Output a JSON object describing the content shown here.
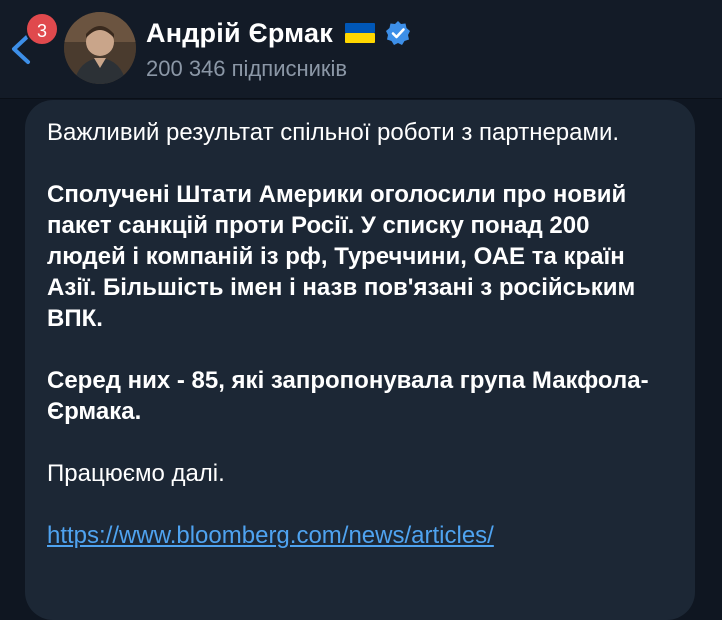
{
  "header": {
    "unread_count": "3",
    "channel_name": "Андрій Єрмак",
    "subscribers": "200 346 підписників",
    "flag_icon": "ukraine-flag-icon",
    "verified_icon": "verified-badge-icon",
    "back_icon": "chevron-left-icon",
    "colors": {
      "badge": "#e0494d",
      "verified": "#3d8fe8",
      "back": "#3d8fe8",
      "flag_blue": "#0057b7",
      "flag_yellow": "#ffd700"
    }
  },
  "message": {
    "paragraphs": [
      "Важливий результат спільної роботи з партнерами.",
      "Сполучені Штати Америки оголосили про новий пакет санкцій проти Росії. У списку понад 200 людей і компаній із рф, Туреччини, ОАЕ та країн Азії. Більшість імен і назв пов'язані з російським ВПК.",
      "Серед них - 85, які запропонувала група Макфола-Єрмака.",
      "Працюємо далі."
    ],
    "link": "https://www.bloomberg.com/news/articles/",
    "colors": {
      "bubble": "#1c2735",
      "link": "#4fa3f0"
    }
  }
}
